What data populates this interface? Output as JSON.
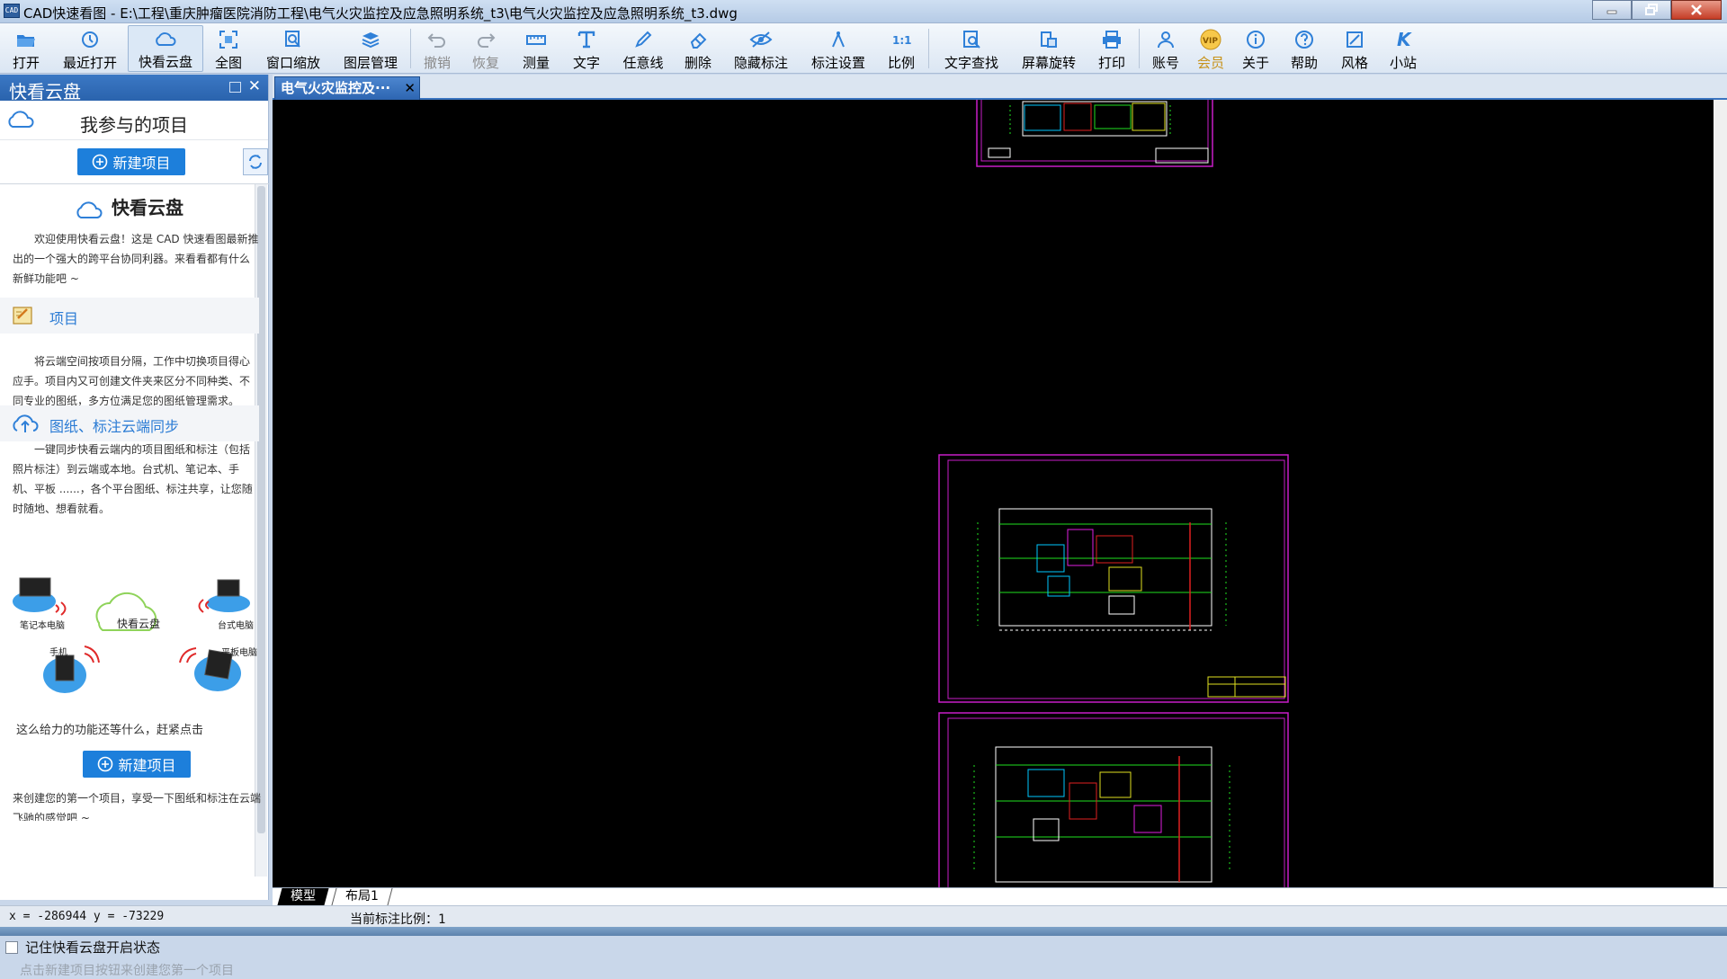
{
  "window": {
    "title": "CAD快速看图 - E:\\工程\\重庆肿瘤医院消防工程\\电气火灾监控及应急照明系统_t3\\电气火灾监控及应急照明系统_t3.dwg",
    "app_icon_text": "CAD"
  },
  "toolbar": {
    "open": "打开",
    "recent": "最近打开",
    "cloud": "快看云盘",
    "fit": "全图",
    "zoom_window": "窗口缩放",
    "layers": "图层管理",
    "undo": "撤销",
    "redo": "恢复",
    "measure": "测量",
    "text": "文字",
    "freeline": "任意线",
    "delete": "删除",
    "hide_annot": "隐藏标注",
    "annot_settings": "标注设置",
    "scale": "比例",
    "find_text": "文字查找",
    "rotate": "屏幕旋转",
    "print": "打印",
    "account": "账号",
    "vip": "会员",
    "about": "关于",
    "help": "帮助",
    "style": "风格",
    "site": "小站"
  },
  "sidebar": {
    "header": "快看云盘",
    "close_glyph": "✕",
    "my_projects": "我参与的项目",
    "new_project": "新建项目",
    "kk_title": "快看云盘",
    "intro": "欢迎使用快看云盘！这是 CAD 快速看图最新推出的一个强大的跨平台协同利器。来看看都有什么新鲜功能吧 ~",
    "sec1_title": "项目",
    "sec1_text": "将云端空间按项目分隔，工作中切换项目得心应手。项目内又可创建文件夹来区分不同种类、不同专业的图纸，多方位满足您的图纸管理需求。",
    "sec2_title": "图纸、标注云端同步",
    "sec2_text": "一键同步快看云端内的项目图纸和标注（包括照片标注）到云端或本地。台式机、笔记本、手机、平板 ......，各个平台图纸、标注共享，让您随时随地、想看就看。",
    "illus": {
      "laptop": "笔记本电脑",
      "desktop": "台式电脑",
      "cloud": "快看云盘",
      "phone": "手机",
      "tablet": "平板电脑"
    },
    "tagline": "这么给力的功能还等什么，赶紧点击",
    "new_project_mid": "新建项目",
    "footer": "来创建您的第一个项目，享受一下图纸和标注在云端飞驰的感觉吧 ~",
    "remember": "记住快看云盘开启状态",
    "hint": "点击新建项目按钮来创建您第一个项目"
  },
  "doc_tab": {
    "label": "电气火灾监控及···",
    "close_glyph": "✕"
  },
  "layout_tabs": {
    "model": "模型",
    "layout1": "布局1"
  },
  "status": {
    "coords": "x = -286944 y = -73229",
    "scale": "当前标注比例：1"
  },
  "colors": {
    "accent": "#1d7fdb",
    "sheet_border": "#c81ec8",
    "canvas_bg": "#000000"
  }
}
